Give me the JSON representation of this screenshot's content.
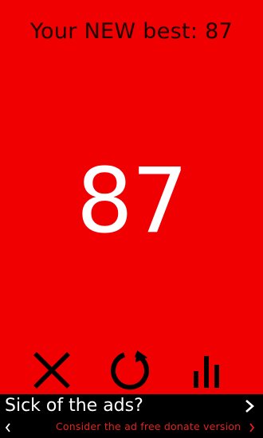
{
  "game": {
    "best_label": "Your NEW best: 87",
    "score": "87"
  },
  "controls": {
    "close_icon": "close-icon",
    "restart_icon": "restart-icon",
    "stats_icon": "bar-chart-icon"
  },
  "ad": {
    "title": "Sick of the ads?",
    "subtitle": "Consider the ad free donate version",
    "next_icon": "chevron-right-icon",
    "prev_icon": "chevron-left-icon"
  },
  "colors": {
    "background": "#f00000",
    "text_dark": "#1b0000",
    "score": "#ffffff",
    "ad_background": "#000000",
    "ad_subtitle": "#e32222"
  }
}
